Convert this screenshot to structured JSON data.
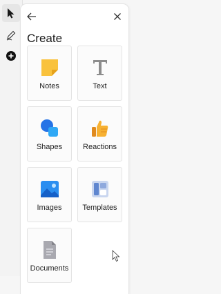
{
  "toolbar": {
    "tools": [
      {
        "name": "select-tool",
        "icon": "cursor-arrow-icon"
      },
      {
        "name": "pen-tool",
        "icon": "pen-icon"
      },
      {
        "name": "add-tool",
        "icon": "plus-circle-icon"
      }
    ]
  },
  "panel": {
    "title": "Create",
    "back_icon": "arrow-left-icon",
    "close_icon": "close-icon"
  },
  "items": [
    {
      "label": "Notes",
      "icon": "sticky-note-icon"
    },
    {
      "label": "Text",
      "icon": "text-icon"
    },
    {
      "label": "Shapes",
      "icon": "shapes-icon"
    },
    {
      "label": "Reactions",
      "icon": "thumbs-up-icon"
    },
    {
      "label": "Images",
      "icon": "image-icon"
    },
    {
      "label": "Templates",
      "icon": "templates-icon"
    },
    {
      "label": "Documents",
      "icon": "document-icon"
    }
  ],
  "colors": {
    "notes": "#f9c23c",
    "text": "#8c8c8c",
    "shapes": "#1e8ff0",
    "reactions": "#f7a832",
    "images": "#2a8ef0",
    "templates": "#6b8fd0",
    "documents": "#a9a9b0"
  }
}
